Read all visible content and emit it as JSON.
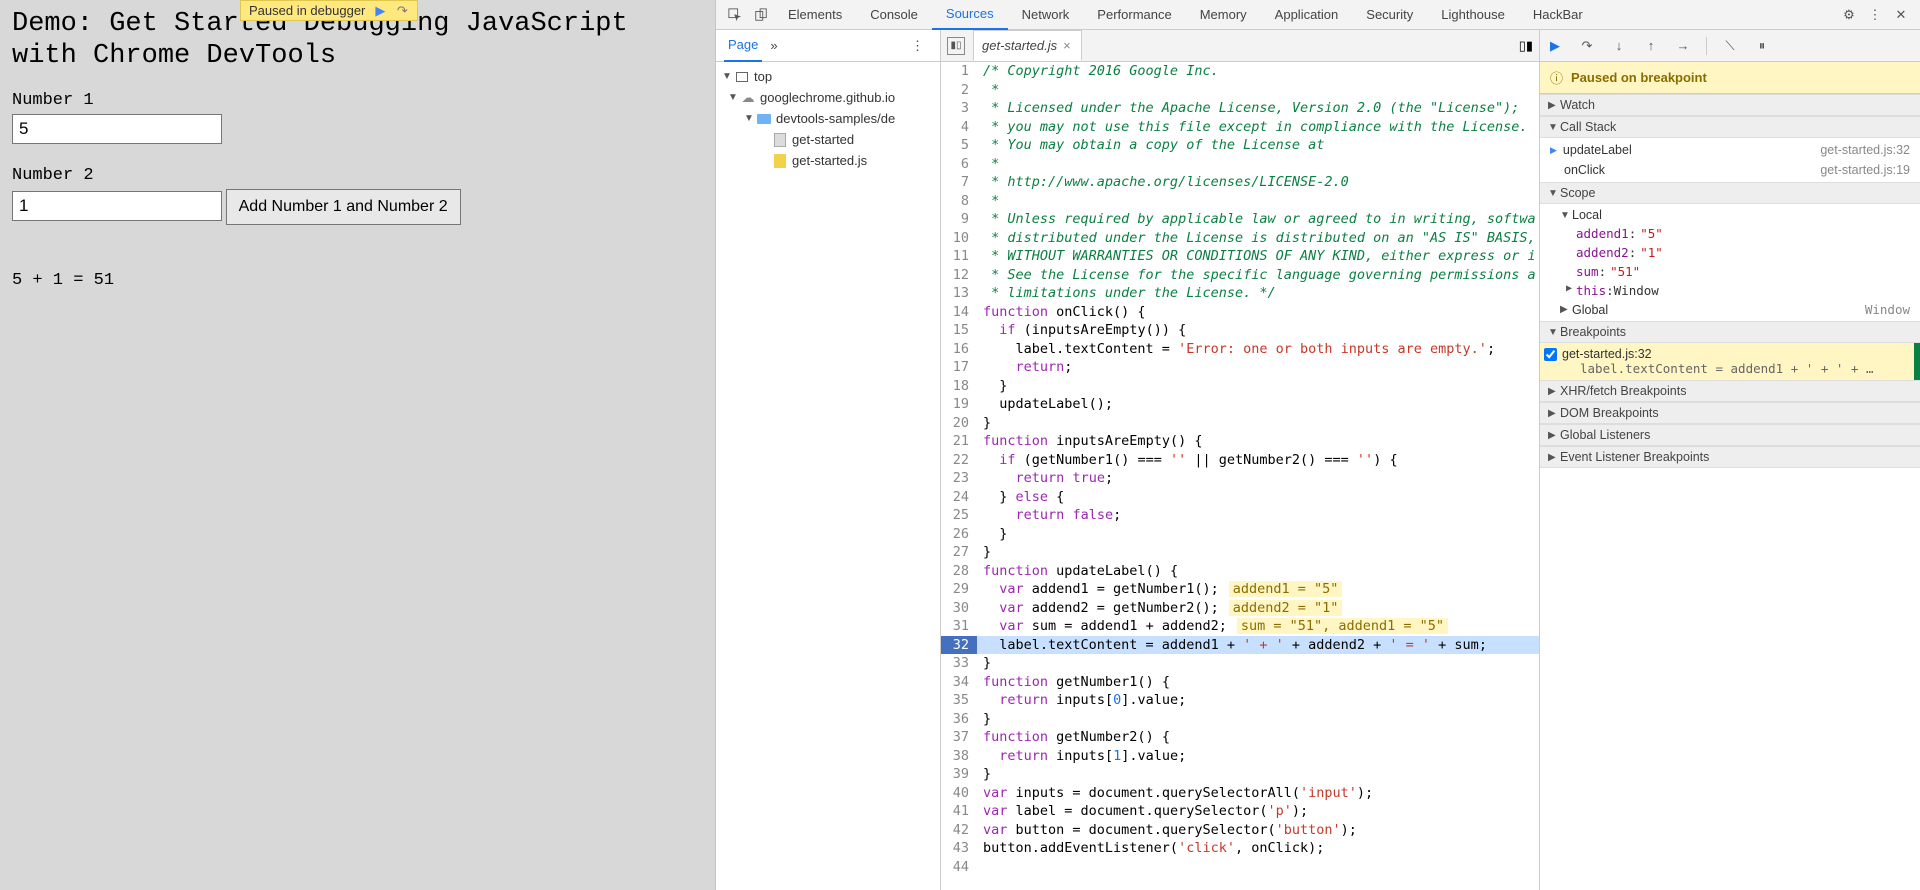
{
  "demo": {
    "title": "Demo: Get Started Debugging JavaScript with Chrome DevTools",
    "num1_label": "Number 1",
    "num1_value": "5",
    "num2_label": "Number 2",
    "num2_value": "1",
    "button_label": "Add Number 1 and Number 2",
    "result": "5 + 1 = 51"
  },
  "paused_overlay": {
    "text": "Paused in debugger"
  },
  "devtools_tabs": [
    "Elements",
    "Console",
    "Sources",
    "Network",
    "Performance",
    "Memory",
    "Application",
    "Security",
    "Lighthouse",
    "HackBar"
  ],
  "devtools_active_tab": "Sources",
  "navigator": {
    "tab": "Page",
    "tree": {
      "top": "top",
      "origin": "googlechrome.github.io",
      "folder": "devtools-samples/de",
      "files": [
        "get-started",
        "get-started.js"
      ]
    }
  },
  "editor": {
    "open_file": "get-started.js",
    "exec_line": 32,
    "lines": [
      {
        "n": 1,
        "t": "/* Copyright 2016 Google Inc.",
        "cls": "c"
      },
      {
        "n": 2,
        "t": " *",
        "cls": "c"
      },
      {
        "n": 3,
        "t": " * Licensed under the Apache License, Version 2.0 (the \"License\");",
        "cls": "c"
      },
      {
        "n": 4,
        "t": " * you may not use this file except in compliance with the License.",
        "cls": "c"
      },
      {
        "n": 5,
        "t": " * You may obtain a copy of the License at",
        "cls": "c"
      },
      {
        "n": 6,
        "t": " *",
        "cls": "c"
      },
      {
        "n": 7,
        "t": " * http://www.apache.org/licenses/LICENSE-2.0",
        "cls": "c"
      },
      {
        "n": 8,
        "t": " *",
        "cls": "c"
      },
      {
        "n": 9,
        "t": " * Unless required by applicable law or agreed to in writing, softwa",
        "cls": "c"
      },
      {
        "n": 10,
        "t": " * distributed under the License is distributed on an \"AS IS\" BASIS,",
        "cls": "c"
      },
      {
        "n": 11,
        "t": " * WITHOUT WARRANTIES OR CONDITIONS OF ANY KIND, either express or i",
        "cls": "c"
      },
      {
        "n": 12,
        "t": " * See the License for the specific language governing permissions a",
        "cls": "c"
      },
      {
        "n": 13,
        "t": " * limitations under the License. */",
        "cls": "c"
      },
      {
        "n": 14,
        "t": "function onClick() {"
      },
      {
        "n": 15,
        "t": "  if (inputsAreEmpty()) {"
      },
      {
        "n": 16,
        "t": "    label.textContent = 'Error: one or both inputs are empty.';"
      },
      {
        "n": 17,
        "t": "    return;"
      },
      {
        "n": 18,
        "t": "  }"
      },
      {
        "n": 19,
        "t": "  updateLabel();"
      },
      {
        "n": 20,
        "t": "}"
      },
      {
        "n": 21,
        "t": "function inputsAreEmpty() {"
      },
      {
        "n": 22,
        "t": "  if (getNumber1() === '' || getNumber2() === '') {"
      },
      {
        "n": 23,
        "t": "    return true;"
      },
      {
        "n": 24,
        "t": "  } else {"
      },
      {
        "n": 25,
        "t": "    return false;"
      },
      {
        "n": 26,
        "t": "  }"
      },
      {
        "n": 27,
        "t": "}"
      },
      {
        "n": 28,
        "t": "function updateLabel() {"
      },
      {
        "n": 29,
        "t": "  var addend1 = getNumber1();",
        "iv": "addend1 = \"5\""
      },
      {
        "n": 30,
        "t": "  var addend2 = getNumber2();",
        "iv": "addend2 = \"1\""
      },
      {
        "n": 31,
        "t": "  var sum = addend1 + addend2;",
        "iv": "sum = \"51\", addend1 = \"5\""
      },
      {
        "n": 32,
        "t": "  label.textContent = addend1 + ' + ' + addend2 + ' = ' + sum;"
      },
      {
        "n": 33,
        "t": "}"
      },
      {
        "n": 34,
        "t": "function getNumber1() {"
      },
      {
        "n": 35,
        "t": "  return inputs[0].value;"
      },
      {
        "n": 36,
        "t": "}"
      },
      {
        "n": 37,
        "t": "function getNumber2() {"
      },
      {
        "n": 38,
        "t": "  return inputs[1].value;"
      },
      {
        "n": 39,
        "t": "}"
      },
      {
        "n": 40,
        "t": "var inputs = document.querySelectorAll('input');"
      },
      {
        "n": 41,
        "t": "var label = document.querySelector('p');"
      },
      {
        "n": 42,
        "t": "var button = document.querySelector('button');"
      },
      {
        "n": 43,
        "t": "button.addEventListener('click', onClick);"
      },
      {
        "n": 44,
        "t": ""
      }
    ]
  },
  "debugger": {
    "paused_msg": "Paused on breakpoint",
    "watch_h": "Watch",
    "callstack_h": "Call Stack",
    "callstack": [
      {
        "fn": "updateLabel",
        "loc": "get-started.js:32",
        "current": true
      },
      {
        "fn": "onClick",
        "loc": "get-started.js:19",
        "current": false
      }
    ],
    "scope_h": "Scope",
    "scope_local": "Local",
    "scope_vars": [
      {
        "k": "addend1",
        "v": "\"5\""
      },
      {
        "k": "addend2",
        "v": "\"1\""
      },
      {
        "k": "sum",
        "v": "\"51\""
      }
    ],
    "scope_this": {
      "k": "this",
      "v": "Window"
    },
    "scope_global": "Global",
    "scope_global_v": "Window",
    "breakpoints_h": "Breakpoints",
    "breakpoint": {
      "file": "get-started.js:32",
      "code": "label.textContent = addend1 + ' + ' + …"
    },
    "xhr_h": "XHR/fetch Breakpoints",
    "dom_h": "DOM Breakpoints",
    "gl_h": "Global Listeners",
    "el_h": "Event Listener Breakpoints"
  }
}
